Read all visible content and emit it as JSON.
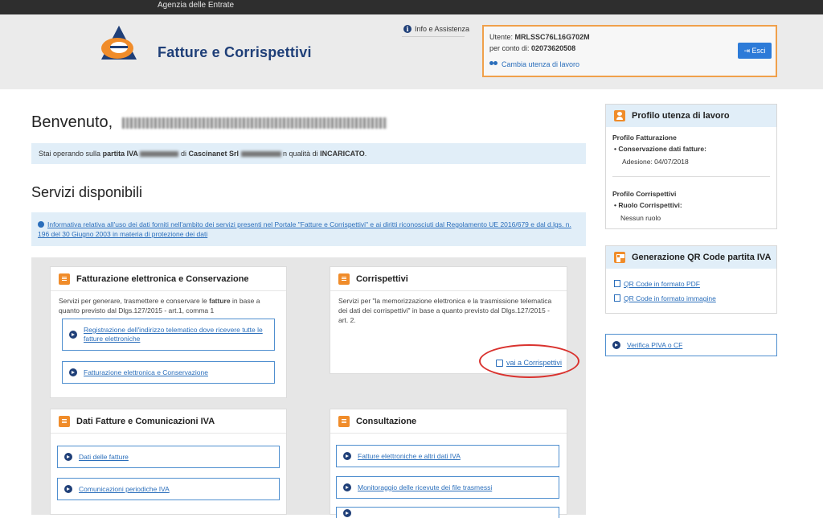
{
  "topbar": {
    "label": "Agenzia delle Entrate"
  },
  "header": {
    "app_title": "Fatture e Corrispettivi",
    "info_link": "Info e Assistenza",
    "user_label": "Utente:",
    "user_code": "MRLSSC76L16G702M",
    "account_label": "per conto di:",
    "account_code": "02073620508",
    "change_link": "Cambia utenza di lavoro",
    "exit_button": "Esci"
  },
  "main": {
    "welcome": "Benvenuto,",
    "notice_pre": "Stai operando sulla",
    "notice_piva": "partita IVA",
    "notice_di": "di",
    "notice_company": "Cascinanet Srl",
    "notice_qual": "n qualità di",
    "notice_role": "INCARICATO",
    "services_title": "Servizi disponibili",
    "privacy_text": "Informativa relativa all'uso dei dati forniti nell'ambito dei servizi presenti nel Portale \"Fatture e Corrispettivi\" e ai diritti riconosciuti dal Regolamento UE 2016/679 e dal d.lgs. n. 196 del 30 Giugno 2003 in materia di protezione dei dati"
  },
  "cards": {
    "fatturazione": {
      "title": "Fatturazione elettronica e Conservazione",
      "desc_pre": "Servizi per generare, trasmettere e conservare le",
      "desc_bold": "fatture",
      "desc_post": "in base a quanto previsto dal Dlgs.127/2015 - art.1, comma 1",
      "link1": "Registrazione dell'indirizzo telematico dove ricevere tutte le fatture elettroniche",
      "link2": "Fatturazione elettronica e Conservazione"
    },
    "corrispettivi": {
      "title": "Corrispettivi",
      "desc": "Servizi per \"la memorizzazione elettronica e la trasmissione telematica dei dati dei corrispettivi\" in base a quanto previsto dal Dlgs.127/2015 - art. 2.",
      "link": "vai a Corrispettivi"
    },
    "dati_fatture": {
      "title": "Dati Fatture e Comunicazioni IVA",
      "link1": "Dati delle fatture",
      "link2": "Comunicazioni periodiche IVA"
    },
    "consultazione": {
      "title": "Consultazione",
      "link1": "Fatture elettroniche e altri dati IVA",
      "link2": "Monitoraggio delle ricevute dei file trasmessi"
    }
  },
  "sidebar": {
    "profile": {
      "title": "Profilo utenza di lavoro",
      "fatt_heading": "Profilo Fatturazione",
      "fatt_item": "Conservazione dati fatture:",
      "fatt_value": "Adesione: 04/07/2018",
      "corr_heading": "Profilo Corrispettivi",
      "corr_item": "Ruolo Corrispettivi:",
      "corr_value": "Nessun ruolo"
    },
    "qr": {
      "title": "Generazione QR Code partita IVA",
      "link_pdf": "QR Code in formato PDF",
      "link_img": "QR Code in formato immagine"
    },
    "verify": {
      "label": "Verifica PIVA o CF"
    }
  }
}
